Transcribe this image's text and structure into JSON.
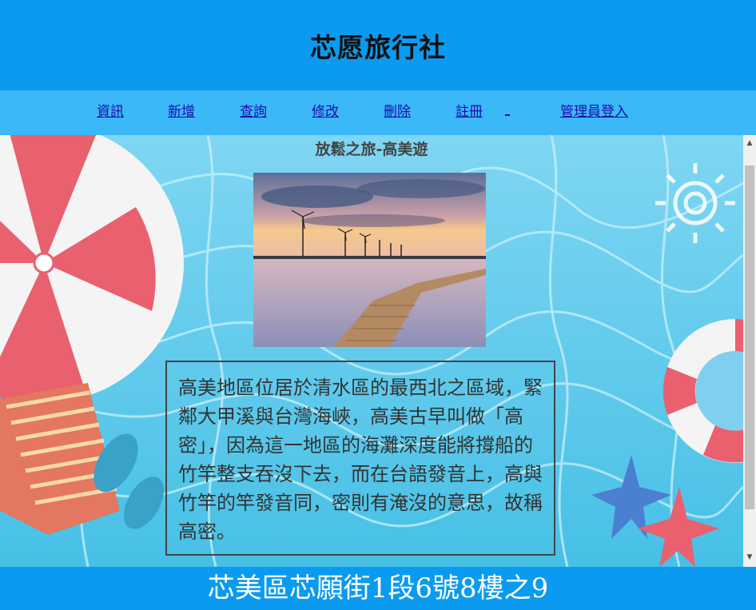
{
  "header": {
    "title": "芯愿旅行社"
  },
  "nav": {
    "items": [
      {
        "label": "資訊"
      },
      {
        "label": "新增"
      },
      {
        "label": "查詢"
      },
      {
        "label": "修改"
      },
      {
        "label": "刪除"
      },
      {
        "label": "註冊"
      },
      {
        "label": "管理員登入"
      }
    ]
  },
  "main": {
    "subtitle": "放鬆之旅-高美遊",
    "description": "高美地區位居於清水區的最西北之區域，緊鄰大甲溪與台灣海峽，高美古早叫做「高密」，因為這一地區的海灘深度能將撐船的竹竿整支吞沒下去，而在台語發音上，高與竹竿的竿發音同，密則有淹沒的意思，故稱高密。"
  },
  "footer": {
    "address": "芯美區芯願街1段6號8樓之9"
  },
  "colors": {
    "header_bg": "#0a9bf0",
    "nav_bg": "#3bb8f7",
    "link": "#1a0dab",
    "footer_bg": "#0a9bf0"
  },
  "icons": [
    "beach-umbrella-image",
    "life-ring-image",
    "starfish-image",
    "sun-image",
    "scroll-up-icon",
    "scroll-down-icon"
  ]
}
